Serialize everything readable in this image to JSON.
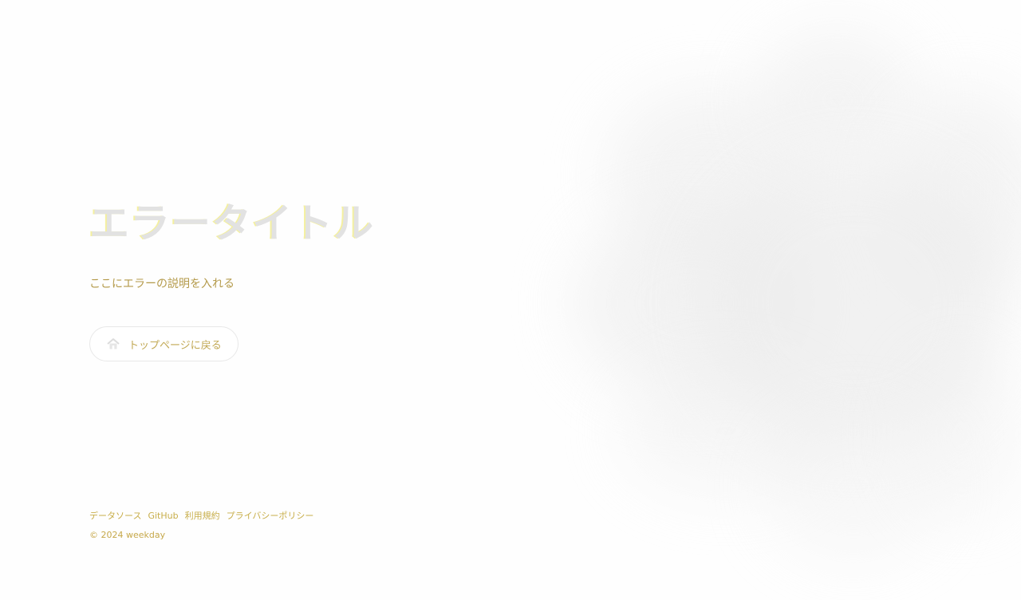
{
  "error": {
    "title": "エラータイトル",
    "description": "ここにエラーの説明を入れる",
    "home_button_label": "トップページに戻る",
    "home_button_icon": "home-icon"
  },
  "footer": {
    "links": [
      {
        "label": "データソース"
      },
      {
        "label": "GitHub"
      },
      {
        "label": "利用規約"
      },
      {
        "label": "プライバシーポリシー"
      }
    ],
    "copyright": "© 2024 weekday"
  },
  "colors": {
    "background": "#fefefe",
    "title": "#e2e2e2",
    "accent_text": "#c2a955",
    "blob": "#ececec"
  }
}
